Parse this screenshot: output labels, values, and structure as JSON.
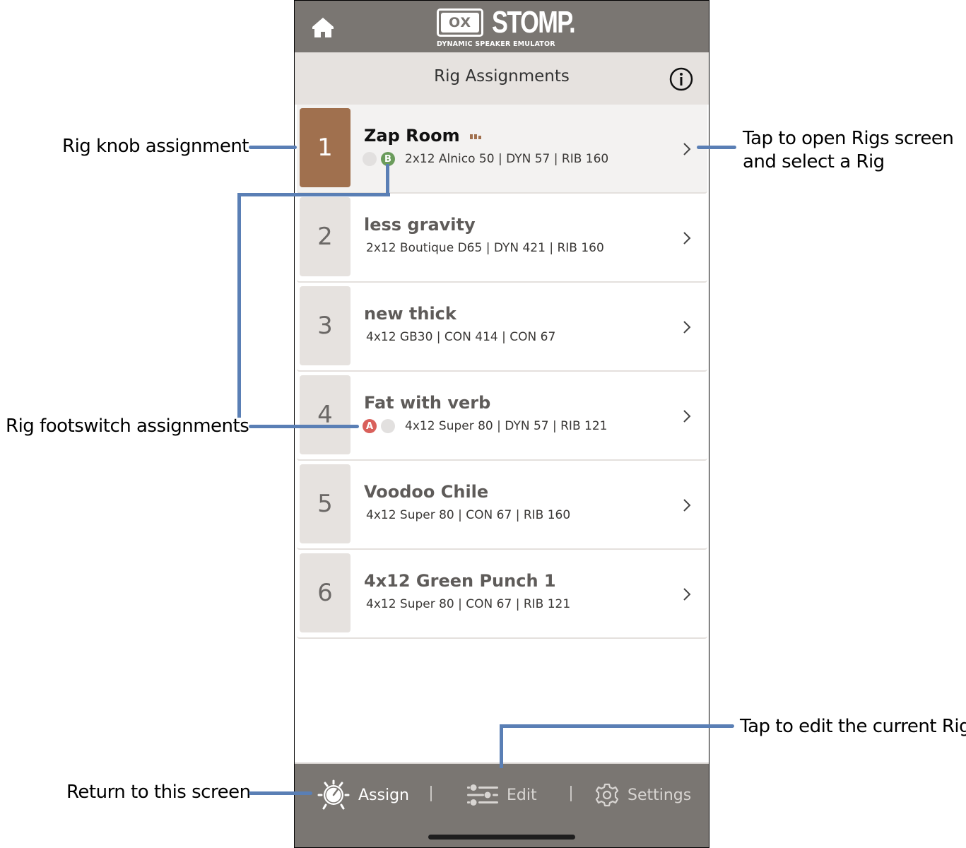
{
  "app": {
    "logo_mark": "OX",
    "logo_word": "STOMP.",
    "logo_subtitle": "DYNAMIC SPEAKER EMULATOR",
    "page_title": "Rig Assignments"
  },
  "colors": {
    "bar_bg": "#7a7672",
    "title_bg": "#e6e2df",
    "active_knob": "#a0704e",
    "footswitch_a": "#d9605b",
    "footswitch_b": "#6b9c5c",
    "callout_line": "#5a7fb5"
  },
  "rigs": [
    {
      "number": "1",
      "name": "Zap Room",
      "detail": "2x12 Alnico 50 | DYN 57 | RIB 160",
      "active": true,
      "footswitches": [
        "",
        "B"
      ]
    },
    {
      "number": "2",
      "name": "less gravity",
      "detail": "2x12 Boutique D65 | DYN 421 | RIB 160",
      "active": false,
      "footswitches": []
    },
    {
      "number": "3",
      "name": "new thick",
      "detail": "4x12 GB30 | CON 414 | CON 67",
      "active": false,
      "footswitches": []
    },
    {
      "number": "4",
      "name": "Fat with verb",
      "detail": "4x12 Super 80 | DYN 57 | RIB 121",
      "active": false,
      "footswitches": [
        "A",
        ""
      ]
    },
    {
      "number": "5",
      "name": "Voodoo Chile",
      "detail": "4x12 Super 80 | CON 67 | RIB 160",
      "active": false,
      "footswitches": []
    },
    {
      "number": "6",
      "name": "4x12 Green Punch 1",
      "detail": "4x12 Super 80 | CON 67 | RIB 121",
      "active": false,
      "footswitches": []
    }
  ],
  "nav": {
    "assign": "Assign",
    "separator": "|",
    "edit": "Edit",
    "settings": "Settings",
    "active": "assign"
  },
  "icons": {
    "home": "home-icon",
    "info": "info-icon",
    "chevron": "chevron-right-icon",
    "assign": "knob-icon",
    "edit": "sliders-icon",
    "settings": "gear-icon"
  },
  "callouts": {
    "knob": "Rig knob assignment",
    "footswitch": "Rig footswitch assignments",
    "open_rigs_line1": "Tap to open Rigs screen",
    "open_rigs_line2": "and select a Rig",
    "edit": "Tap to edit the current Rig",
    "return": "Return to this screen"
  }
}
